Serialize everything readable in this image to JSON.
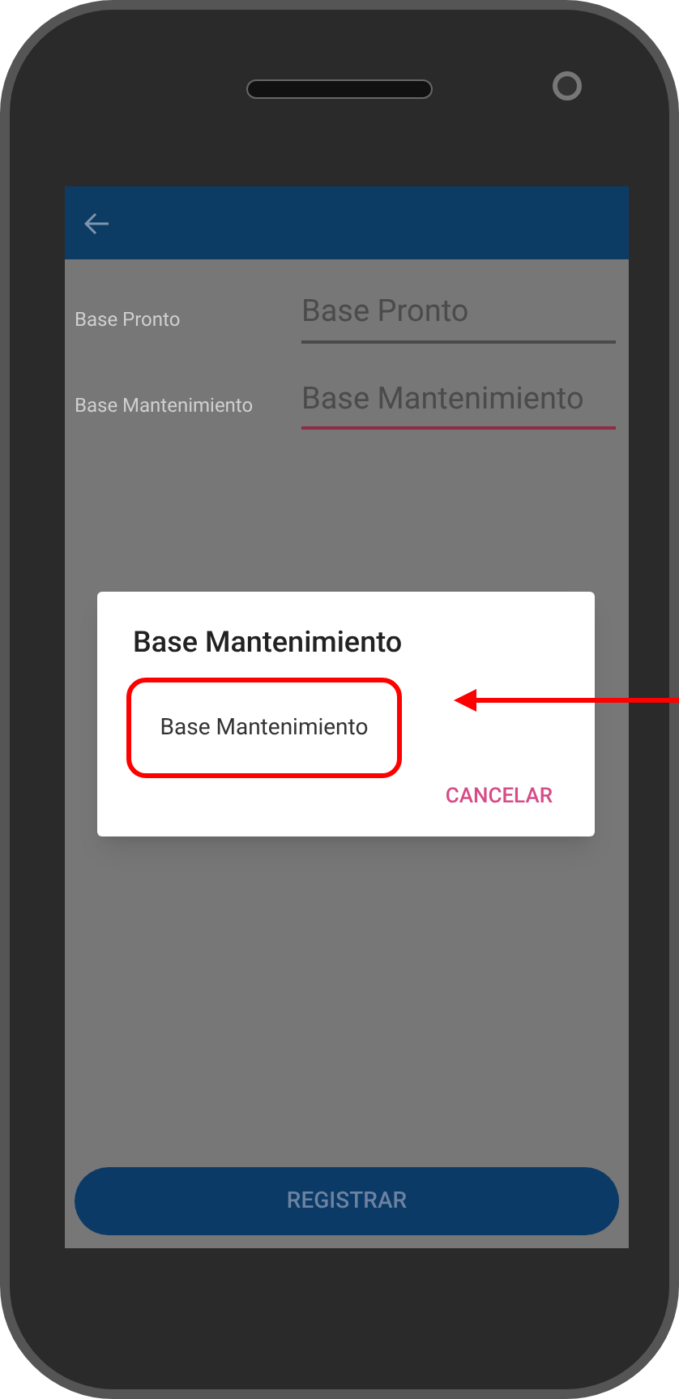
{
  "form": {
    "fields": [
      {
        "label": "Base Pronto",
        "value": "Base Pronto",
        "focused": false
      },
      {
        "label": "Base Mantenimiento",
        "value": "Base Mantenimiento",
        "focused": true
      }
    ]
  },
  "dialog": {
    "title": "Base Mantenimiento",
    "options": [
      "Base Mantenimiento"
    ],
    "buttons": [
      "CANCELAR"
    ]
  },
  "primary_button": "REGISTRAR"
}
